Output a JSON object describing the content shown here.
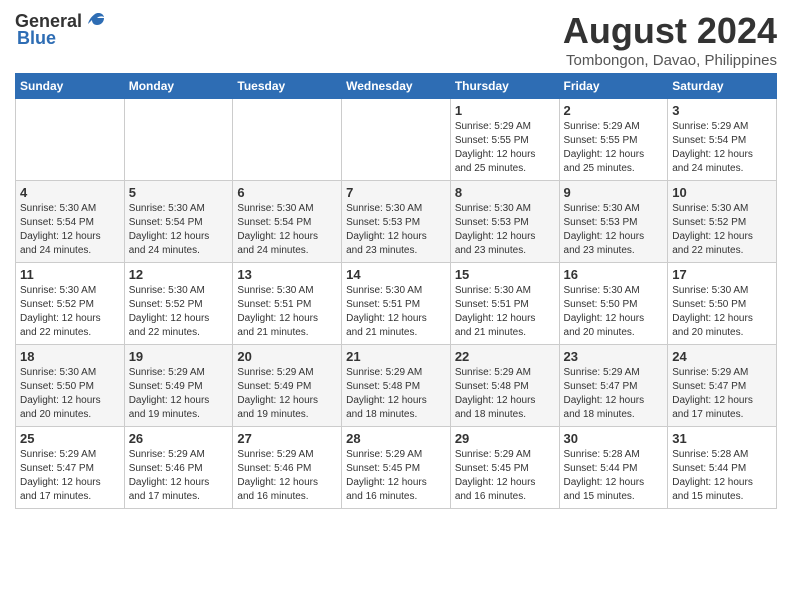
{
  "header": {
    "logo_general": "General",
    "logo_blue": "Blue",
    "title": "August 2024",
    "subtitle": "Tombongon, Davao, Philippines"
  },
  "calendar": {
    "days_of_week": [
      "Sunday",
      "Monday",
      "Tuesday",
      "Wednesday",
      "Thursday",
      "Friday",
      "Saturday"
    ],
    "weeks": [
      [
        {
          "day": "",
          "info": ""
        },
        {
          "day": "",
          "info": ""
        },
        {
          "day": "",
          "info": ""
        },
        {
          "day": "",
          "info": ""
        },
        {
          "day": "1",
          "info": "Sunrise: 5:29 AM\nSunset: 5:55 PM\nDaylight: 12 hours\nand 25 minutes."
        },
        {
          "day": "2",
          "info": "Sunrise: 5:29 AM\nSunset: 5:55 PM\nDaylight: 12 hours\nand 25 minutes."
        },
        {
          "day": "3",
          "info": "Sunrise: 5:29 AM\nSunset: 5:54 PM\nDaylight: 12 hours\nand 24 minutes."
        }
      ],
      [
        {
          "day": "4",
          "info": "Sunrise: 5:30 AM\nSunset: 5:54 PM\nDaylight: 12 hours\nand 24 minutes."
        },
        {
          "day": "5",
          "info": "Sunrise: 5:30 AM\nSunset: 5:54 PM\nDaylight: 12 hours\nand 24 minutes."
        },
        {
          "day": "6",
          "info": "Sunrise: 5:30 AM\nSunset: 5:54 PM\nDaylight: 12 hours\nand 24 minutes."
        },
        {
          "day": "7",
          "info": "Sunrise: 5:30 AM\nSunset: 5:53 PM\nDaylight: 12 hours\nand 23 minutes."
        },
        {
          "day": "8",
          "info": "Sunrise: 5:30 AM\nSunset: 5:53 PM\nDaylight: 12 hours\nand 23 minutes."
        },
        {
          "day": "9",
          "info": "Sunrise: 5:30 AM\nSunset: 5:53 PM\nDaylight: 12 hours\nand 23 minutes."
        },
        {
          "day": "10",
          "info": "Sunrise: 5:30 AM\nSunset: 5:52 PM\nDaylight: 12 hours\nand 22 minutes."
        }
      ],
      [
        {
          "day": "11",
          "info": "Sunrise: 5:30 AM\nSunset: 5:52 PM\nDaylight: 12 hours\nand 22 minutes."
        },
        {
          "day": "12",
          "info": "Sunrise: 5:30 AM\nSunset: 5:52 PM\nDaylight: 12 hours\nand 22 minutes."
        },
        {
          "day": "13",
          "info": "Sunrise: 5:30 AM\nSunset: 5:51 PM\nDaylight: 12 hours\nand 21 minutes."
        },
        {
          "day": "14",
          "info": "Sunrise: 5:30 AM\nSunset: 5:51 PM\nDaylight: 12 hours\nand 21 minutes."
        },
        {
          "day": "15",
          "info": "Sunrise: 5:30 AM\nSunset: 5:51 PM\nDaylight: 12 hours\nand 21 minutes."
        },
        {
          "day": "16",
          "info": "Sunrise: 5:30 AM\nSunset: 5:50 PM\nDaylight: 12 hours\nand 20 minutes."
        },
        {
          "day": "17",
          "info": "Sunrise: 5:30 AM\nSunset: 5:50 PM\nDaylight: 12 hours\nand 20 minutes."
        }
      ],
      [
        {
          "day": "18",
          "info": "Sunrise: 5:30 AM\nSunset: 5:50 PM\nDaylight: 12 hours\nand 20 minutes."
        },
        {
          "day": "19",
          "info": "Sunrise: 5:29 AM\nSunset: 5:49 PM\nDaylight: 12 hours\nand 19 minutes."
        },
        {
          "day": "20",
          "info": "Sunrise: 5:29 AM\nSunset: 5:49 PM\nDaylight: 12 hours\nand 19 minutes."
        },
        {
          "day": "21",
          "info": "Sunrise: 5:29 AM\nSunset: 5:48 PM\nDaylight: 12 hours\nand 18 minutes."
        },
        {
          "day": "22",
          "info": "Sunrise: 5:29 AM\nSunset: 5:48 PM\nDaylight: 12 hours\nand 18 minutes."
        },
        {
          "day": "23",
          "info": "Sunrise: 5:29 AM\nSunset: 5:47 PM\nDaylight: 12 hours\nand 18 minutes."
        },
        {
          "day": "24",
          "info": "Sunrise: 5:29 AM\nSunset: 5:47 PM\nDaylight: 12 hours\nand 17 minutes."
        }
      ],
      [
        {
          "day": "25",
          "info": "Sunrise: 5:29 AM\nSunset: 5:47 PM\nDaylight: 12 hours\nand 17 minutes."
        },
        {
          "day": "26",
          "info": "Sunrise: 5:29 AM\nSunset: 5:46 PM\nDaylight: 12 hours\nand 17 minutes."
        },
        {
          "day": "27",
          "info": "Sunrise: 5:29 AM\nSunset: 5:46 PM\nDaylight: 12 hours\nand 16 minutes."
        },
        {
          "day": "28",
          "info": "Sunrise: 5:29 AM\nSunset: 5:45 PM\nDaylight: 12 hours\nand 16 minutes."
        },
        {
          "day": "29",
          "info": "Sunrise: 5:29 AM\nSunset: 5:45 PM\nDaylight: 12 hours\nand 16 minutes."
        },
        {
          "day": "30",
          "info": "Sunrise: 5:28 AM\nSunset: 5:44 PM\nDaylight: 12 hours\nand 15 minutes."
        },
        {
          "day": "31",
          "info": "Sunrise: 5:28 AM\nSunset: 5:44 PM\nDaylight: 12 hours\nand 15 minutes."
        }
      ]
    ]
  }
}
